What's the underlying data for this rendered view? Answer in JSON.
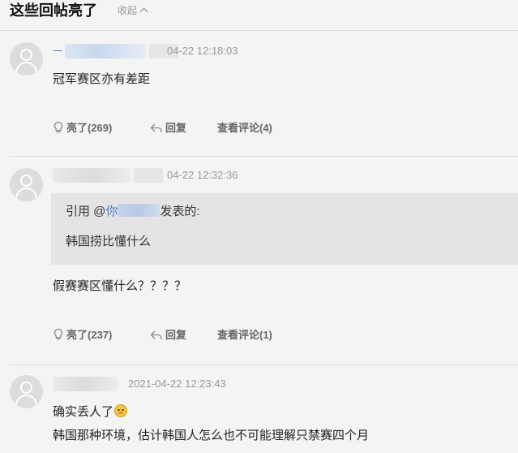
{
  "header": {
    "title": "这些回帖亮了",
    "collapse_label": "收起"
  },
  "replies": [
    {
      "username": "一",
      "time": "04-22 12:18:03",
      "content": "冠军赛区亦有差距",
      "actions": {
        "light": "亮了(269)",
        "reply": "回复",
        "comments": "查看评论(4)"
      }
    },
    {
      "username": "",
      "time": "04-22 12:32:36",
      "quote": {
        "prefix": "引用 @",
        "user": "你",
        "suffix": "发表的:",
        "text": "韩国捞比懂什么"
      },
      "content": "假赛赛区懂什么？？？？",
      "actions": {
        "light": "亮了(237)",
        "reply": "回复",
        "comments": "查看评论(1)"
      }
    },
    {
      "username": "",
      "time": "2021-04-22 12:23:43",
      "content": "确实丢人了",
      "content2": "韩国那种环境，估计韩国人怎么也不可能理解只禁赛四个月"
    }
  ],
  "icons": {
    "light": "bulb-icon",
    "reply": "reply-arrow-icon",
    "collapse": "chevron-up-icon",
    "emoji": "sad-face-emoji"
  },
  "colors": {
    "link": "#4a78c8",
    "muted": "#999999",
    "quote_bg": "#e4e4e4",
    "page_bg": "#f4f4f4"
  }
}
